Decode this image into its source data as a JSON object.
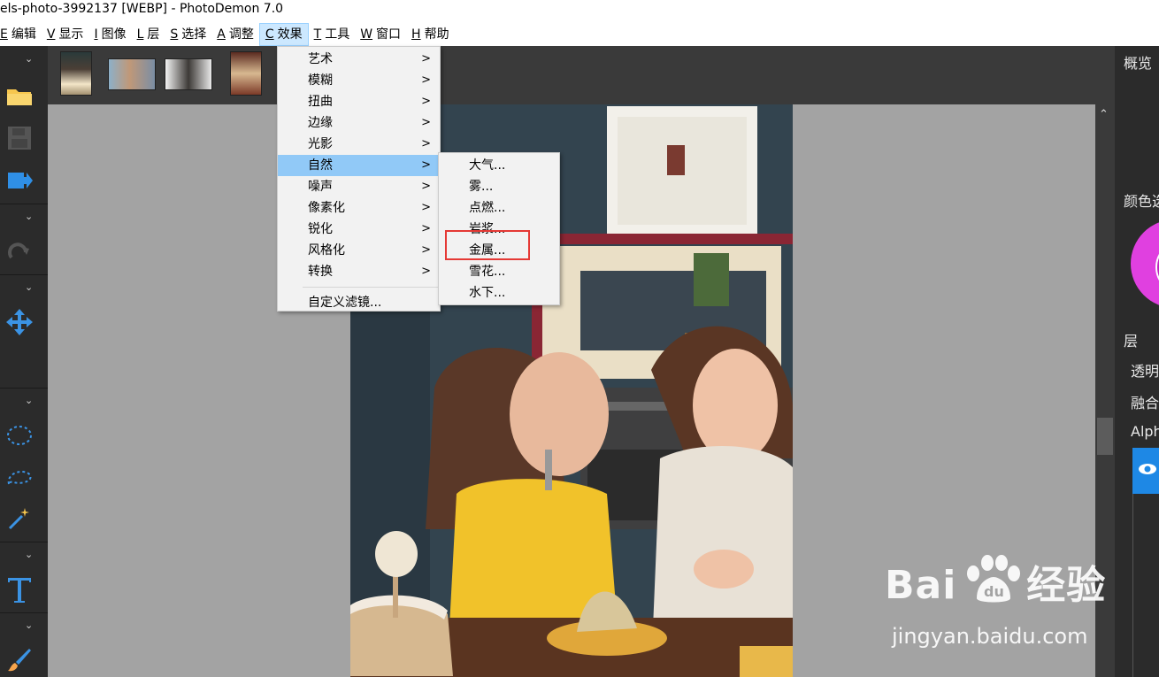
{
  "window": {
    "title": "els-photo-3992137 [WEBP]  -  PhotoDemon 7.0"
  },
  "menubar": [
    {
      "key": "E",
      "label": "编辑"
    },
    {
      "key": "V",
      "label": "显示"
    },
    {
      "key": "I",
      "label": "图像"
    },
    {
      "key": "L",
      "label": "层"
    },
    {
      "key": "S",
      "label": "选择"
    },
    {
      "key": "A",
      "label": "调整"
    },
    {
      "key": "C",
      "label": "效果"
    },
    {
      "key": "T",
      "label": "工具"
    },
    {
      "key": "W",
      "label": "窗口"
    },
    {
      "key": "H",
      "label": "帮助"
    }
  ],
  "effects_menu": {
    "items": [
      "艺术",
      "模糊",
      "扭曲",
      "边缘",
      "光影",
      "自然",
      "噪声",
      "像素化",
      "锐化",
      "风格化",
      "转换"
    ],
    "highlighted": "自然",
    "custom_filter": "自定义滤镜..."
  },
  "nature_submenu": {
    "items": [
      "大气...",
      "雾...",
      "点燃...",
      "岩浆...",
      "金属...",
      "雪花...",
      "水下..."
    ],
    "boxed": "金属..."
  },
  "right_panel": {
    "overview": "概览",
    "color": "颜色选",
    "layers": "层",
    "opacity": "透明",
    "blend": "融合",
    "alpha": "Alph"
  },
  "watermark": {
    "brand": "Bai",
    "brand_cn": "经验",
    "url": "jingyan.baidu.com"
  },
  "colors": {
    "accent_blue": "#1e88e5",
    "menu_highlight": "#91c9f7",
    "red_box": "#e53935"
  }
}
